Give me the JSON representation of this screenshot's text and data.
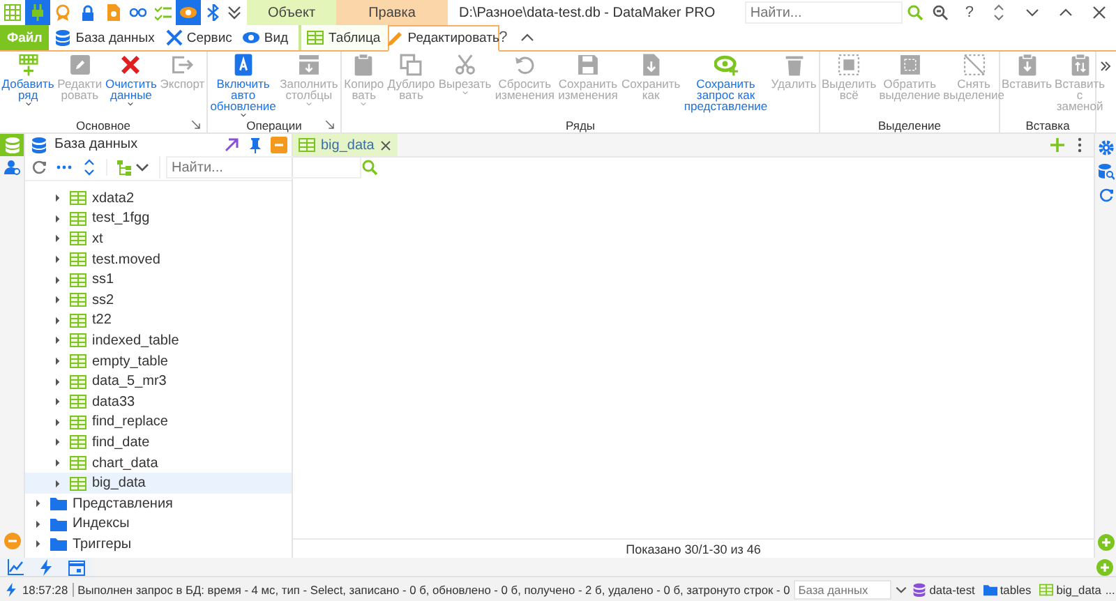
{
  "quick_access": [
    {
      "pressed": false
    },
    {
      "pressed": true
    },
    {
      "pressed": false
    },
    {
      "pressed": false
    },
    {
      "pressed": false
    },
    {
      "pressed": false
    },
    {
      "pressed": false
    },
    {
      "pressed": true
    },
    {
      "pressed": false
    }
  ],
  "context_tabs": [
    {
      "label": "Объект",
      "color": "#e3f5b8"
    },
    {
      "label": "Правка",
      "color": "#fbd6a8"
    }
  ],
  "title": "D:\\Разное\\data-test.db - DataMaker PRO",
  "search": {
    "placeholder": "Найти..."
  },
  "help": "?",
  "ribbon_help": "?",
  "ribbon_tabs": [
    {
      "label": "Файл",
      "kind": "file",
      "selected": false
    },
    {
      "label": "База данных",
      "kind": "tab",
      "selected": false
    },
    {
      "label": "Сервис",
      "kind": "tab",
      "selected": false
    },
    {
      "label": "Вид",
      "kind": "tab",
      "selected": false
    },
    {
      "label": "Таблица",
      "kind": "context",
      "selected": false
    },
    {
      "label": "Редактировать",
      "kind": "context",
      "selected": true
    }
  ],
  "ribbon_groups": [
    {
      "label": "Основное",
      "launcher": true,
      "buttons": [
        {
          "label": "Добавить\nряд",
          "disabled": false,
          "dropdown": true
        },
        {
          "label": "Редакти\nровать",
          "disabled": true,
          "dropdown": false
        },
        {
          "label": "Очистить\nданные",
          "disabled": false,
          "dropdown": true
        },
        {
          "label": "Экспорт",
          "disabled": true,
          "dropdown": false
        }
      ]
    },
    {
      "label": "Операции",
      "launcher": true,
      "buttons": [
        {
          "label": "Включить\nавто\nобновление",
          "disabled": false,
          "dropdown": true
        },
        {
          "label": "Заполнить\nстолбцы",
          "disabled": true,
          "dropdown": true
        }
      ]
    },
    {
      "label": "Ряды",
      "launcher": false,
      "buttons": [
        {
          "label": "Копиро\nвать",
          "disabled": true,
          "dropdown": true
        },
        {
          "label": "Дублиро\nвать",
          "disabled": true,
          "dropdown": false
        },
        {
          "label": "Вырезать",
          "disabled": true,
          "dropdown": true
        },
        {
          "label": "Сбросить\nизменения",
          "disabled": true,
          "dropdown": false
        },
        {
          "label": "Сохранить\nизменения",
          "disabled": true,
          "dropdown": false
        },
        {
          "label": "Сохранить\nкак",
          "disabled": true,
          "dropdown": false
        },
        {
          "label": "Сохранить\nзапрос как\nпредставление",
          "disabled": false,
          "dropdown": false
        },
        {
          "label": "Удалить",
          "disabled": true,
          "dropdown": false
        }
      ]
    },
    {
      "label": "Выделение",
      "launcher": false,
      "buttons": [
        {
          "label": "Выделить\nвсё",
          "disabled": true,
          "dropdown": false
        },
        {
          "label": "Обратить\nвыделение",
          "disabled": true,
          "dropdown": false
        },
        {
          "label": "Снять\nвыделение",
          "disabled": true,
          "dropdown": false
        }
      ]
    },
    {
      "label": "Вставка",
      "launcher": false,
      "buttons": [
        {
          "label": "Вставить",
          "disabled": true,
          "dropdown": false
        },
        {
          "label": "Вставить\nс\nзаменой",
          "disabled": true,
          "dropdown": false
        }
      ]
    }
  ],
  "side_rail": [
    {
      "selected": true
    },
    {
      "selected": false
    }
  ],
  "panel": {
    "title": "База данных",
    "search_placeholder": "Найти..."
  },
  "tree": [
    {
      "children": [
        {
          "label": "xdata2",
          "kind": "table",
          "expanded": false,
          "selected": false
        },
        {
          "label": "test_1fgg",
          "kind": "table",
          "expanded": false,
          "selected": false
        },
        {
          "label": "xt",
          "kind": "table",
          "expanded": false,
          "selected": false
        },
        {
          "label": "test.moved",
          "kind": "table",
          "expanded": false,
          "selected": false
        },
        {
          "label": "ss1",
          "kind": "table",
          "expanded": false,
          "selected": false
        },
        {
          "label": "ss2",
          "kind": "table",
          "expanded": false,
          "selected": false
        },
        {
          "label": "t22",
          "kind": "table",
          "expanded": false,
          "selected": false
        },
        {
          "label": "indexed_table",
          "kind": "table",
          "expanded": false,
          "selected": false
        },
        {
          "label": "empty_table",
          "kind": "table",
          "expanded": false,
          "selected": false
        },
        {
          "label": "data_5_mr3",
          "kind": "table",
          "expanded": false,
          "selected": false
        },
        {
          "label": "data33",
          "kind": "table",
          "expanded": false,
          "selected": false
        },
        {
          "label": "find_replace",
          "kind": "table",
          "expanded": false,
          "selected": false
        },
        {
          "label": "find_date",
          "kind": "table",
          "expanded": false,
          "selected": false
        },
        {
          "label": "chart_data",
          "kind": "table",
          "expanded": false,
          "selected": false
        },
        {
          "label": "big_data",
          "kind": "table",
          "expanded": false,
          "selected": true
        }
      ]
    },
    {
      "label": "Представления",
      "kind": "folder",
      "expanded": false,
      "selected": false
    },
    {
      "label": "Индексы",
      "kind": "folder",
      "expanded": false,
      "selected": false
    },
    {
      "label": "Триггеры",
      "kind": "folder",
      "expanded": false,
      "selected": false
    }
  ],
  "doc_tabs": [
    {
      "label": "big_data",
      "selected": true
    }
  ],
  "grid_footer": "Показано 30/1-30 из 46",
  "status_bar": {
    "time": "18:57:28",
    "message": "Выполнен запрос в БД: время - 4 мс, тип - Select, записано - 0 б, обновлено - 0 б, получено - 2 б, удалено - 0 б, затронуто строк - 0",
    "database_placeholder": "База данных",
    "breadcrumb": [
      "data-test",
      "tables",
      "big_data"
    ],
    "more": "..."
  }
}
